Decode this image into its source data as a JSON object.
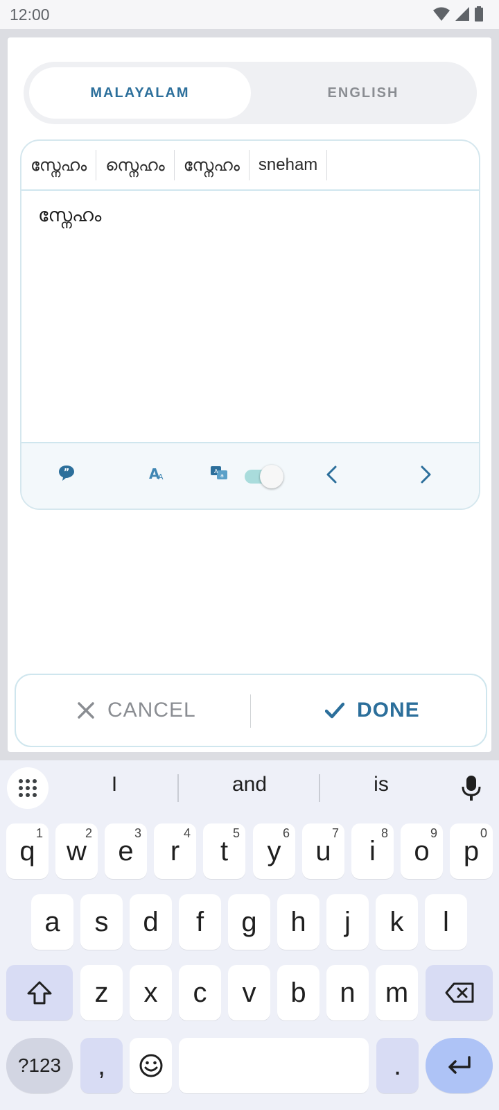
{
  "status_bar": {
    "time": "12:00"
  },
  "language_toggle": {
    "active": "MALAYALAM",
    "inactive": "ENGLISH"
  },
  "editor": {
    "suggestions": [
      "സ്നേഹം",
      "സ്നെഹം",
      "സ്നേഹം",
      "sneham"
    ],
    "text": "സ്നേഹം",
    "toolbar_icons": [
      "quote-icon",
      "font-size-icon",
      "translate-icon",
      "chevron-left-icon",
      "chevron-right-icon"
    ],
    "transliterate_toggle_on": true
  },
  "actions": {
    "cancel": "CANCEL",
    "done": "DONE"
  },
  "keyboard": {
    "suggestions": [
      "I",
      "and",
      "is"
    ],
    "row1": [
      {
        "k": "q",
        "h": "1"
      },
      {
        "k": "w",
        "h": "2"
      },
      {
        "k": "e",
        "h": "3"
      },
      {
        "k": "r",
        "h": "4"
      },
      {
        "k": "t",
        "h": "5"
      },
      {
        "k": "y",
        "h": "6"
      },
      {
        "k": "u",
        "h": "7"
      },
      {
        "k": "i",
        "h": "8"
      },
      {
        "k": "o",
        "h": "9"
      },
      {
        "k": "p",
        "h": "0"
      }
    ],
    "row2": [
      "a",
      "s",
      "d",
      "f",
      "g",
      "h",
      "j",
      "k",
      "l"
    ],
    "row3": [
      "z",
      "x",
      "c",
      "v",
      "b",
      "n",
      "m"
    ],
    "symbols_label": "?123",
    "comma": ",",
    "period": "."
  },
  "colors": {
    "accent": "#2c6f9b",
    "muted": "#8a8d92",
    "border": "#cfe6ee"
  }
}
